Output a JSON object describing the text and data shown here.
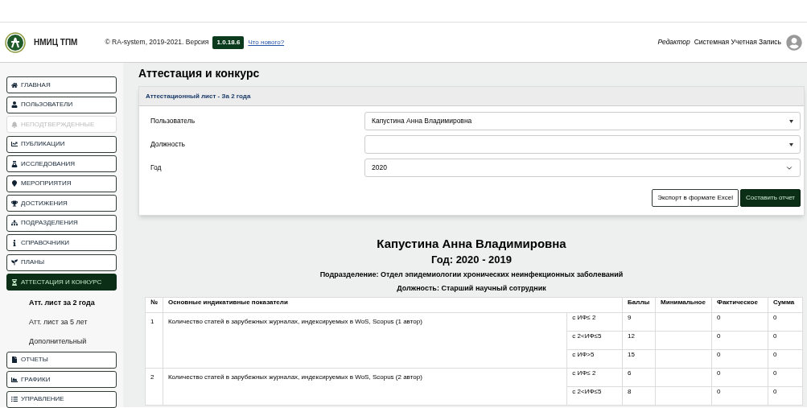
{
  "header": {
    "org": "НМИЦ ТПМ",
    "copyright": "© RA-system, 2019-2021. Версия",
    "version": "1.0.18.6",
    "whats_new": "Что нового?",
    "role": "Редактор",
    "account": "Системная Учетная Запись"
  },
  "sidebar": {
    "items": [
      {
        "kind": "menu",
        "label": "ГЛАВНАЯ",
        "selected": false,
        "disabled": false
      },
      {
        "kind": "menu",
        "label": "ПОЛЬЗОВАТЕЛИ",
        "selected": false,
        "disabled": false
      },
      {
        "kind": "menu",
        "label": "НЕПОДТВЕРЖДЕННЫЕ",
        "selected": false,
        "disabled": true
      },
      {
        "kind": "menu",
        "label": "ПУБЛИКАЦИИ",
        "selected": false,
        "disabled": false
      },
      {
        "kind": "menu",
        "label": "ИССЛЕДОВАНИЯ",
        "selected": false,
        "disabled": false
      },
      {
        "kind": "menu",
        "label": "МЕРОПРИЯТИЯ",
        "selected": false,
        "disabled": false
      },
      {
        "kind": "menu",
        "label": "ДОСТИЖЕНИЯ",
        "selected": false,
        "disabled": false
      },
      {
        "kind": "menu",
        "label": "ПОДРАЗДЕЛЕНИЯ",
        "selected": false,
        "disabled": false
      },
      {
        "kind": "menu",
        "label": "СПРАВОЧНИКИ",
        "selected": false,
        "disabled": false
      },
      {
        "kind": "menu",
        "label": "ПЛАНЫ",
        "selected": false,
        "disabled": false
      },
      {
        "kind": "menu",
        "label": "АТТЕСТАЦИЯ И КОНКУРС",
        "selected": true,
        "disabled": false
      },
      {
        "kind": "sub",
        "label": "Атт. лист за 2 года",
        "selected": true
      },
      {
        "kind": "sub",
        "label": "Атт. лист за 5 лет",
        "selected": false
      },
      {
        "kind": "sub",
        "label": "Дополнительный",
        "selected": false
      },
      {
        "kind": "menu",
        "label": "ОТЧЕТЫ",
        "selected": false,
        "disabled": false
      },
      {
        "kind": "menu",
        "label": "ГРАФИКИ",
        "selected": false,
        "disabled": false
      },
      {
        "kind": "menu",
        "label": "УПРАВЛЕНИЕ",
        "selected": false,
        "disabled": false
      }
    ]
  },
  "page_title": "Аттестация и конкурс",
  "form": {
    "title": "Аттестационный лист - За 2 года",
    "fields": [
      {
        "kind": "combo",
        "label": "Пользователь",
        "value": "Капустина Анна Владимировна"
      },
      {
        "kind": "combo",
        "label": "Должность"
      },
      {
        "kind": "select",
        "label": "Год",
        "value": "2020"
      }
    ],
    "buttons": [
      {
        "kind": "outline",
        "label": "Экспорт в формате Excel"
      },
      {
        "kind": "primary",
        "label": "Составить отчет"
      }
    ]
  },
  "report": {
    "name": "Капустина Анна Владимировна",
    "year": "Год: 2020 - 2019",
    "department": "Подразделение: Отдел эпидемиологии хронических неинфекционных заболеваний",
    "position": "Должность: Старший научный сотрудник",
    "table": {
      "columns": [
        "№",
        "Основные индикативные показатели",
        "Баллы",
        "Минимальное",
        "Фактическое",
        "Сумма"
      ],
      "rows": [
        {
          "number": "1",
          "indicator": "Количество статей в зарубежных журналах, индексируемых в WoS, Scopus (1 автор)",
          "sub_rows": [
            {
              "condition": "с ИФ≤ 2",
              "points": "9",
              "actual": "0",
              "sum": "0"
            },
            {
              "condition": "с 2<ИФ≤5",
              "points": "12",
              "actual": "0",
              "sum": "0"
            },
            {
              "condition": "с ИФ>5",
              "points": "15",
              "actual": "0",
              "sum": "0"
            }
          ]
        },
        {
          "number": "2",
          "indicator": "Количество статей в зарубежных журналах, индексируемых в WoS, Scopus (2 автор)",
          "sub_rows": [
            {
              "condition": "с ИФ≤ 2",
              "points": "6",
              "actual": "0",
              "sum": "0"
            },
            {
              "condition": "с 2<ИФ≤5",
              "points": "8",
              "actual": "0",
              "sum": "0"
            }
          ]
        }
      ]
    }
  }
}
